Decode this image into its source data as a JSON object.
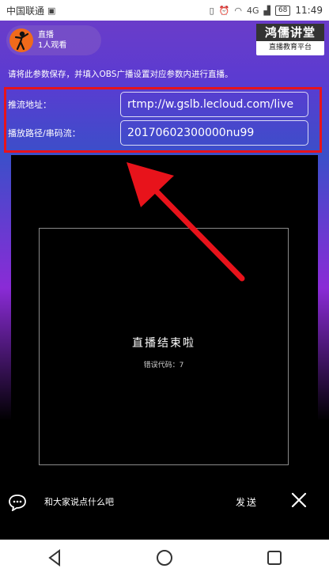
{
  "statusbar": {
    "carrier": "中国联通",
    "network": "4G",
    "battery": "68",
    "time": "11:49"
  },
  "host": {
    "status": "直播",
    "viewers": "1人观看"
  },
  "brand": {
    "name": "鸿儒讲堂",
    "subtitle": "直播教育平台"
  },
  "notice": "请将此参数保存，并填入OBS广播设置对应参数内进行直播。",
  "stream": {
    "push_label": "推流地址：",
    "push_value": "rtmp://w.gslb.lecloud.com/live",
    "path_label": "播放路径/串码流：",
    "path_value": "20170602300000nu99"
  },
  "player": {
    "end_title": "直播结束啦",
    "error_code": "错误代码：7"
  },
  "chat": {
    "placeholder": "和大家说点什么吧",
    "send_label": "发送"
  },
  "colors": {
    "highlight": "#e8131b",
    "accent": "#5b3bd1"
  }
}
